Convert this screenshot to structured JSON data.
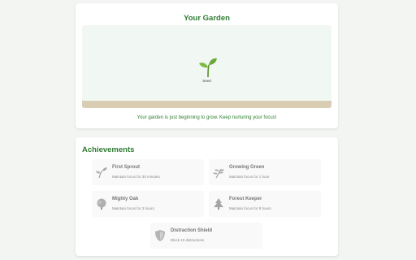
{
  "garden": {
    "title": "Your Garden",
    "stage_label": "Seed",
    "message": "Your garden is just beginning to grow. Keep nurturing your focus!",
    "colors": {
      "accent": "#2e7d32",
      "garden_bg": "#f1f7f2",
      "soil": "#d9cdb4"
    }
  },
  "achievements": {
    "title": "Achievements",
    "items": [
      {
        "name": "First Sprout",
        "description": "Maintain focus for 30 minutes",
        "icon": "sprout-icon",
        "unlocked": false
      },
      {
        "name": "Growing Green",
        "description": "Maintain focus for 1 hour",
        "icon": "herb-icon",
        "unlocked": false
      },
      {
        "name": "Mighty Oak",
        "description": "Maintain focus for 3 hours",
        "icon": "oak-tree-icon",
        "unlocked": false
      },
      {
        "name": "Forest Keeper",
        "description": "Maintain focus for 8 hours",
        "icon": "evergreen-tree-icon",
        "unlocked": false
      },
      {
        "name": "Distraction Shield",
        "description": "Block 10 distractions",
        "icon": "shield-icon",
        "unlocked": false
      }
    ]
  }
}
